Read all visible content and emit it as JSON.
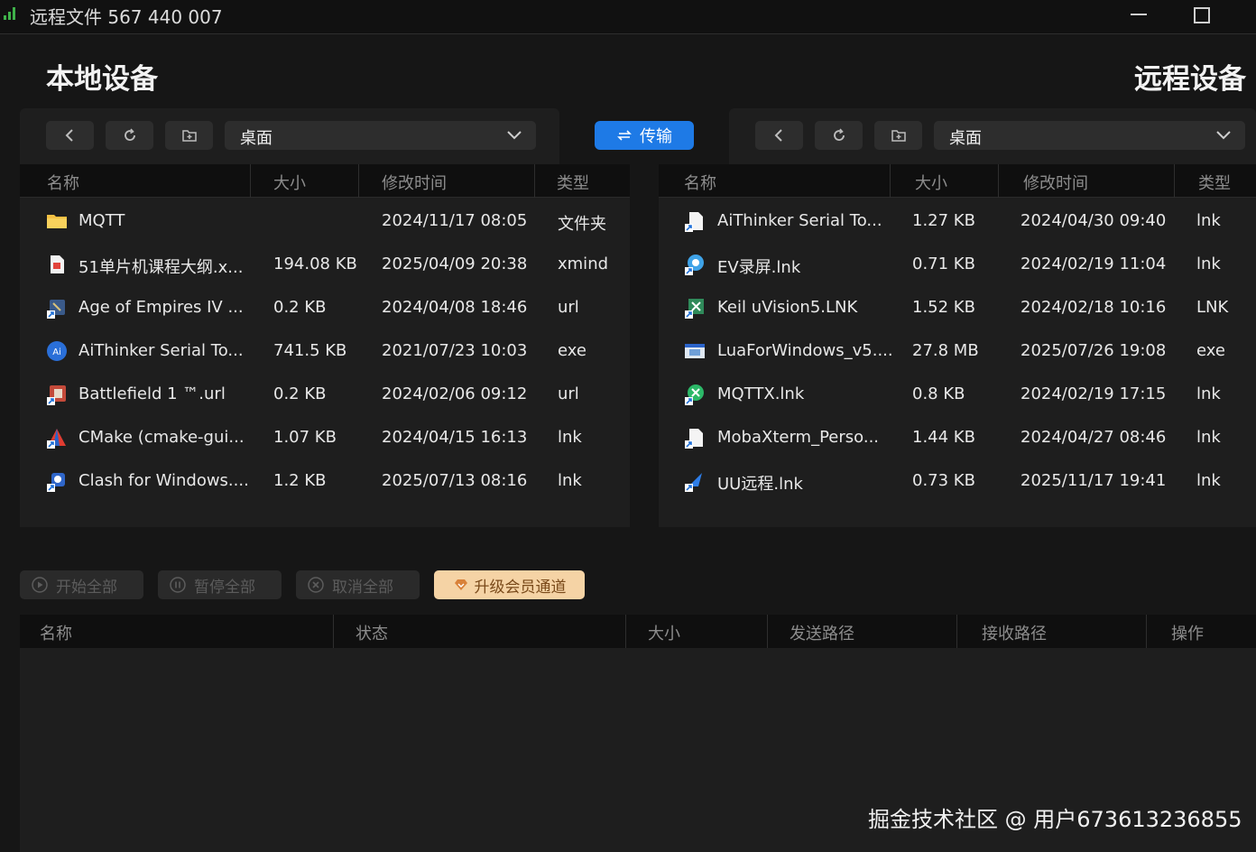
{
  "window": {
    "title": "远程文件 567 440 007"
  },
  "local": {
    "title": "本地设备",
    "path": "桌面",
    "columns": [
      "名称",
      "大小",
      "修改时间",
      "类型"
    ],
    "files": [
      {
        "name": "MQTT",
        "size": "",
        "modified": "2024/11/17 08:05",
        "type": "文件夹",
        "icon": "folder-icon"
      },
      {
        "name": "51单片机课程大纲.x...",
        "size": "194.08 KB",
        "modified": "2025/04/09 20:38",
        "type": "xmind",
        "icon": "xmind-file-icon"
      },
      {
        "name": "Age of Empires IV ...",
        "size": "0.2 KB",
        "modified": "2024/04/08 18:46",
        "type": "url",
        "icon": "game-shortcut-icon"
      },
      {
        "name": "AiThinker Serial To...",
        "size": "741.5 KB",
        "modified": "2021/07/23 10:03",
        "type": "exe",
        "icon": "aithinker-app-icon"
      },
      {
        "name": "Battlefield 1 ™.url",
        "size": "0.2 KB",
        "modified": "2024/02/06 09:12",
        "type": "url",
        "icon": "battlefield-shortcut-icon"
      },
      {
        "name": "CMake (cmake-gui...",
        "size": "1.07 KB",
        "modified": "2024/04/15 16:13",
        "type": "lnk",
        "icon": "cmake-shortcut-icon"
      },
      {
        "name": "Clash for Windows....",
        "size": "1.2 KB",
        "modified": "2025/07/13 08:16",
        "type": "lnk",
        "icon": "clash-shortcut-icon"
      }
    ]
  },
  "remote": {
    "title": "远程设备",
    "path": "桌面",
    "columns": [
      "名称",
      "大小",
      "修改时间",
      "类型"
    ],
    "files": [
      {
        "name": "AiThinker Serial To...",
        "size": "1.27 KB",
        "modified": "2024/04/30 09:40",
        "type": "lnk",
        "icon": "file-shortcut-icon"
      },
      {
        "name": "EV录屏.lnk",
        "size": "0.71 KB",
        "modified": "2024/02/19 11:04",
        "type": "lnk",
        "icon": "ev-recorder-shortcut-icon"
      },
      {
        "name": "Keil uVision5.LNK",
        "size": "1.52 KB",
        "modified": "2024/02/18 10:16",
        "type": "LNK",
        "icon": "keil-shortcut-icon"
      },
      {
        "name": "LuaForWindows_v5....",
        "size": "27.8 MB",
        "modified": "2025/07/26 19:08",
        "type": "exe",
        "icon": "installer-icon"
      },
      {
        "name": "MQTTX.lnk",
        "size": "0.8 KB",
        "modified": "2024/02/19 17:15",
        "type": "lnk",
        "icon": "mqttx-shortcut-icon"
      },
      {
        "name": "MobaXterm_Perso...",
        "size": "1.44 KB",
        "modified": "2024/04/27 08:46",
        "type": "lnk",
        "icon": "file-shortcut-icon"
      },
      {
        "name": "UU远程.lnk",
        "size": "0.73 KB",
        "modified": "2025/11/17 19:41",
        "type": "lnk",
        "icon": "uu-remote-shortcut-icon"
      }
    ]
  },
  "transfer_button": "传输",
  "tasks": {
    "start_all": "开始全部",
    "pause_all": "暂停全部",
    "cancel_all": "取消全部",
    "upgrade": "升级会员通道",
    "columns": [
      "名称",
      "状态",
      "大小",
      "发送路径",
      "接收路径",
      "操作"
    ]
  },
  "watermark": "掘金技术社区 @ 用户673613236855",
  "colors": {
    "accent": "#1e7ae6",
    "upgrade_bg": "#f5d3a5",
    "signal": "#3fb24a"
  }
}
